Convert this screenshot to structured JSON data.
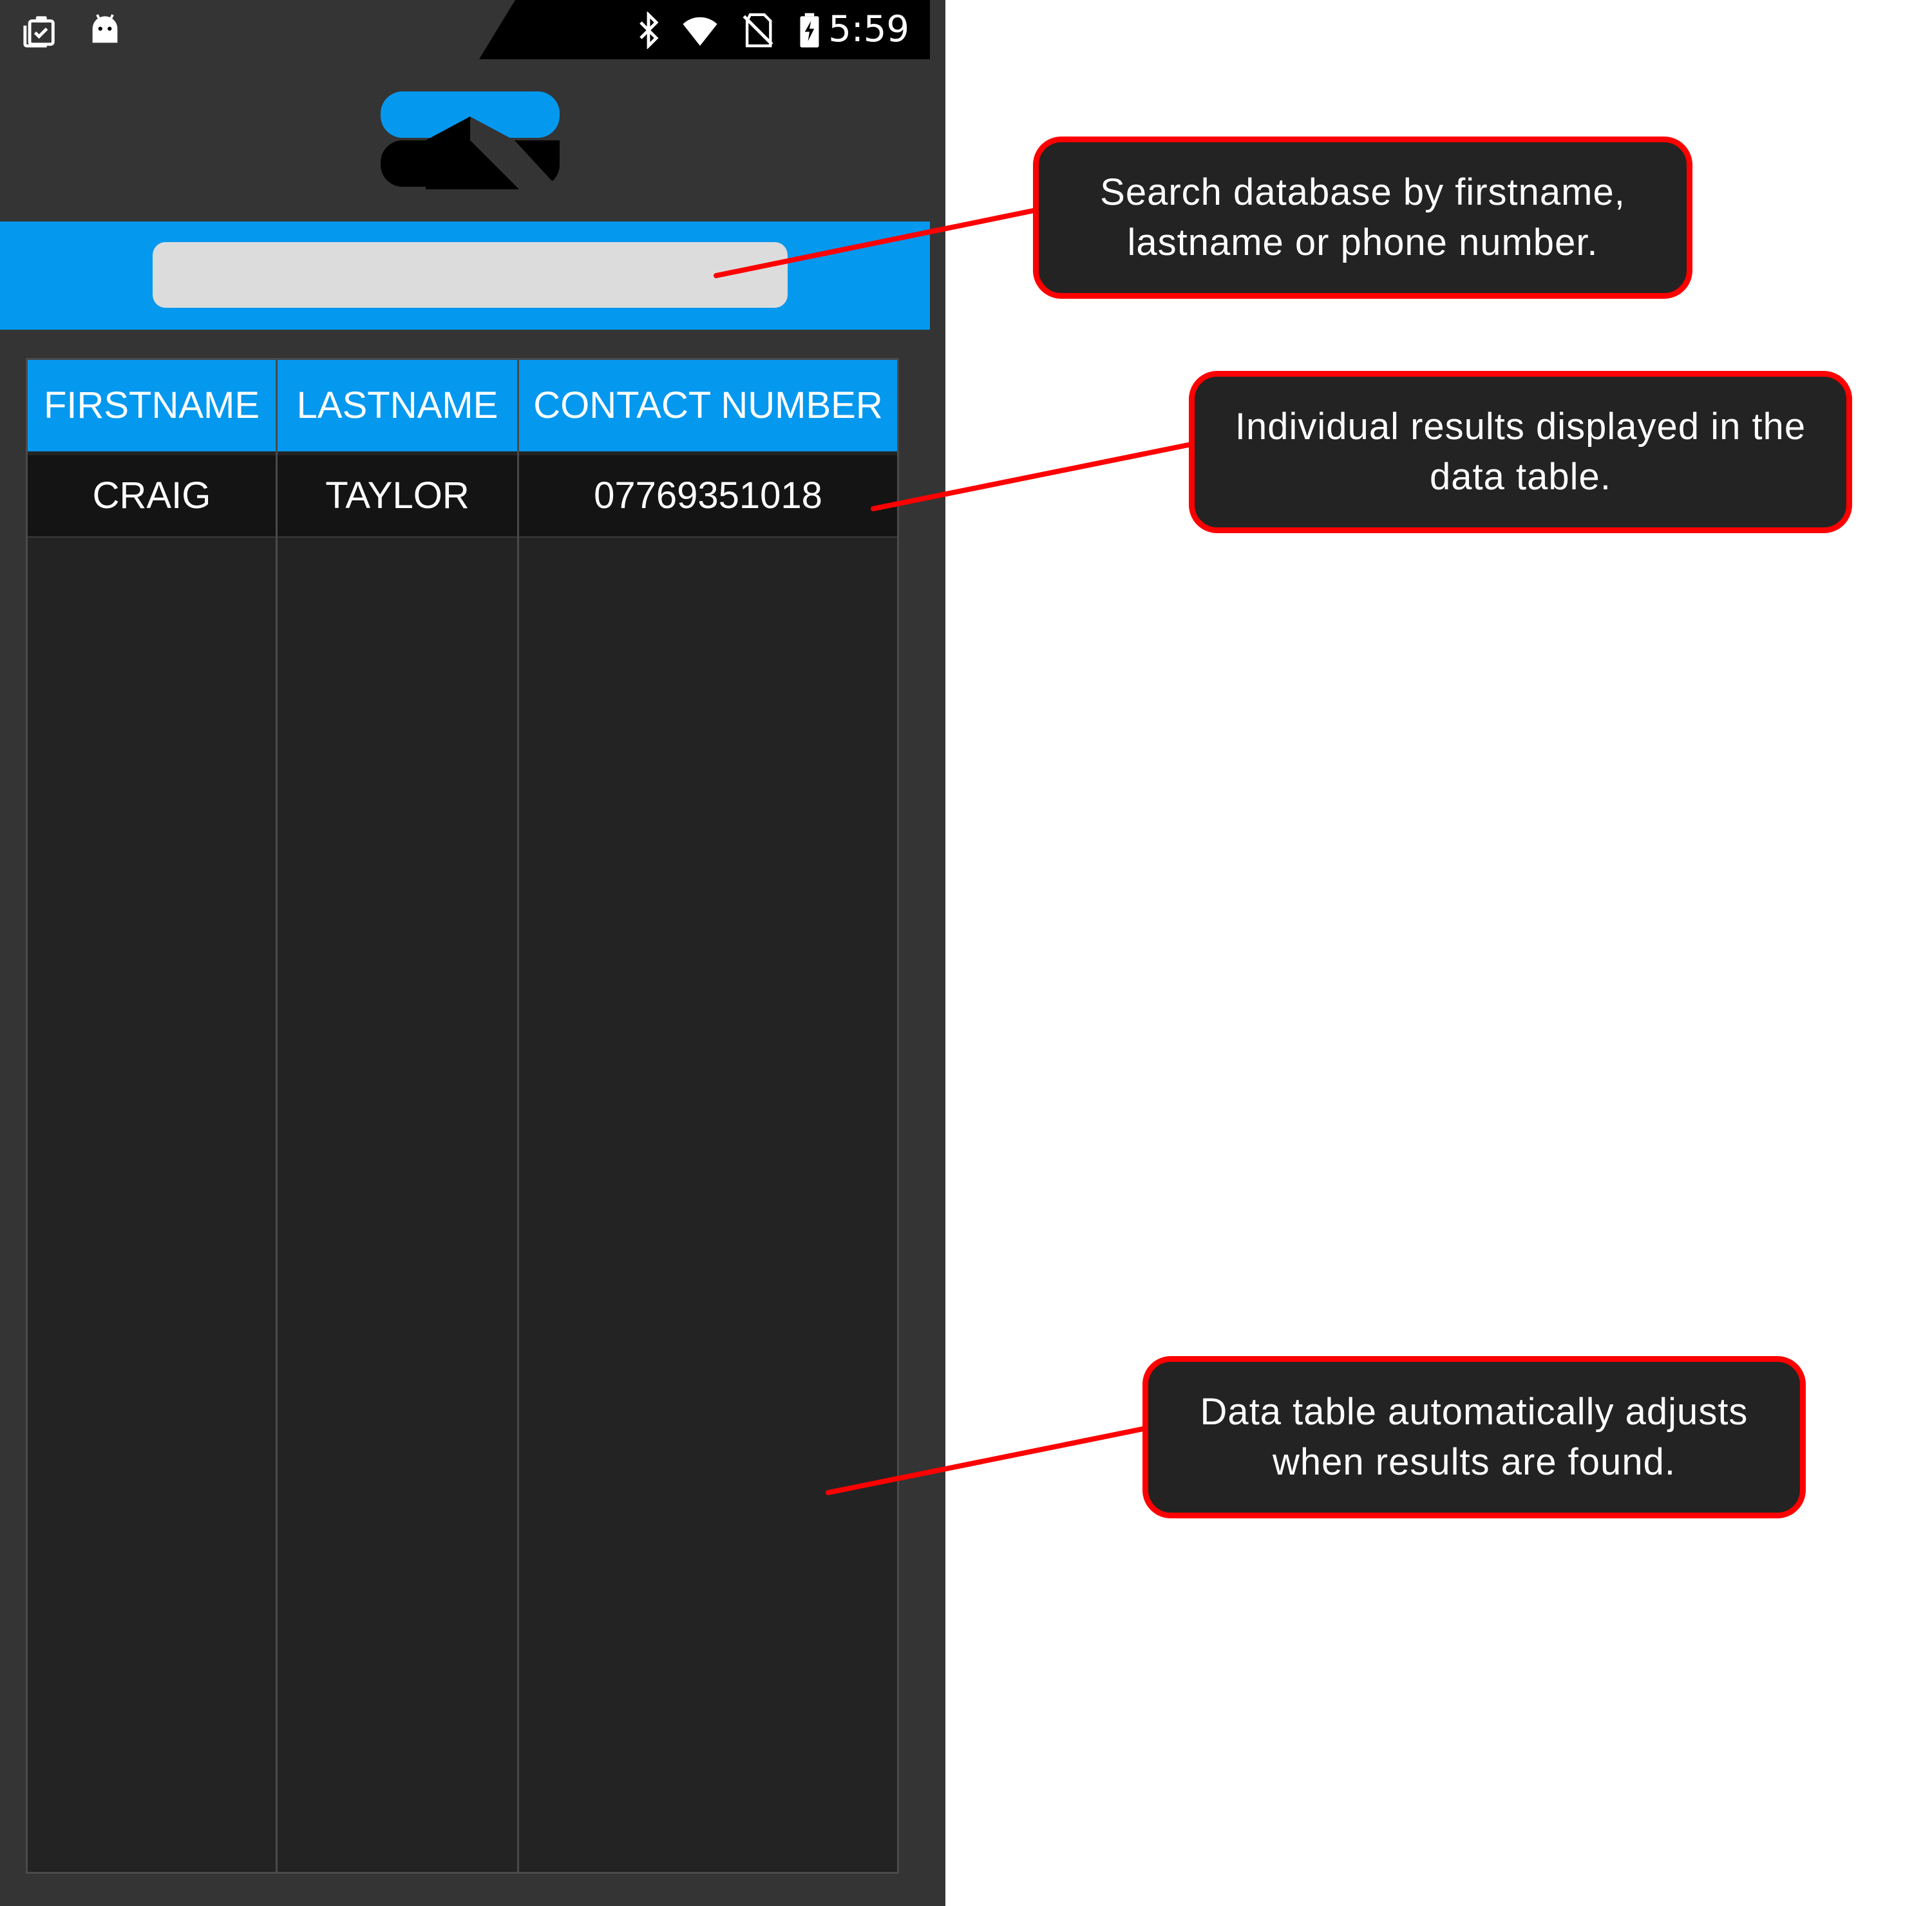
{
  "status_bar": {
    "time": "5:59",
    "left_icons": [
      "clipboard-check-icon",
      "android-icon"
    ],
    "right_icons": [
      "bluetooth-icon",
      "wifi-icon",
      "no-sim-icon",
      "battery-charging-icon"
    ]
  },
  "search": {
    "value": "",
    "placeholder": ""
  },
  "table": {
    "headers": [
      "FIRSTNAME",
      "LASTNAME",
      "CONTACT NUMBER"
    ],
    "rows": [
      [
        "CRAIG",
        "TAYLOR",
        "07769351018"
      ]
    ]
  },
  "annotations": [
    {
      "text": "Search database by firstname, lastname or phone number."
    },
    {
      "text": "Individual results displayed in the data table."
    },
    {
      "text": "Data table automatically adjusts when results are found."
    }
  ],
  "colors": {
    "accent": "#0598ef",
    "background": "#343434",
    "table_bg": "#232323",
    "annotation_border": "#ff0000"
  }
}
